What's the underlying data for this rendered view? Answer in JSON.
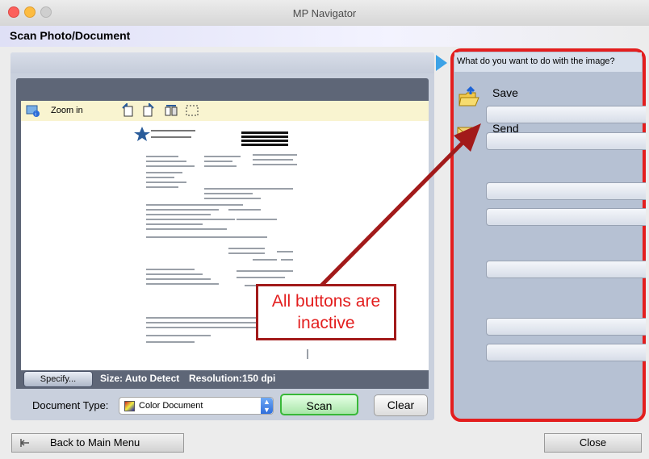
{
  "window": {
    "title": "MP Navigator"
  },
  "header": {
    "title": "Scan Photo/Document"
  },
  "preview": {
    "zoom_label": "Zoom in",
    "specify_label": "Specify...",
    "size_text": "Size: Auto Detect",
    "resolution_text": "Resolution:150 dpi"
  },
  "document_type": {
    "label": "Document Type:",
    "value": "Color Document"
  },
  "actions": {
    "scan_label": "Scan",
    "clear_label": "Clear"
  },
  "right_panel": {
    "question": "What do you want to do with the image?",
    "save_label": "Save",
    "send_label": "Send"
  },
  "callout": {
    "line1": "All buttons are",
    "line2": "inactive"
  },
  "footer": {
    "back_label": "Back to Main Menu",
    "close_label": "Close"
  },
  "colors": {
    "callout": "#e31e1e",
    "highlight_border": "#e31e1e",
    "scan_border": "#38b838"
  }
}
